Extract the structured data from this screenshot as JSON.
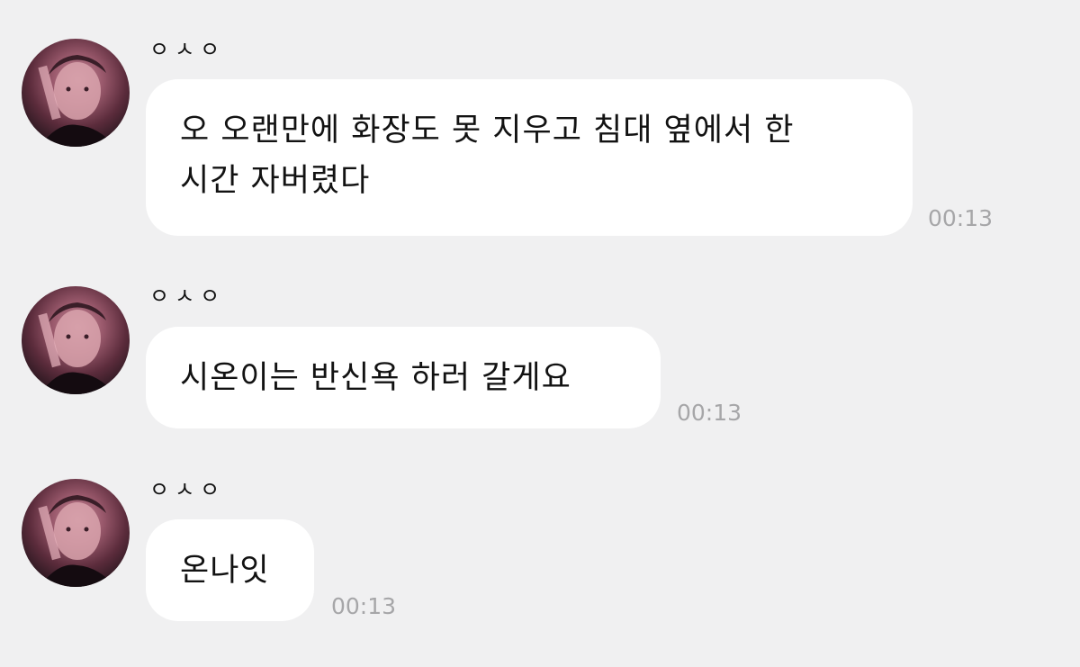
{
  "messages": [
    {
      "sender": "ㅇㅅㅇ",
      "text": "오 오랜만에 화장도 못 지우고 침대 옆에서 한\n시간 자버렸다",
      "time": "00:13"
    },
    {
      "sender": "ㅇㅅㅇ",
      "text": "시온이는 반신욕 하러 갈게요",
      "time": "00:13"
    },
    {
      "sender": "ㅇㅅㅇ",
      "text": "온나잇",
      "time": "00:13"
    }
  ],
  "colors": {
    "background": "#f0f0f1",
    "bubble": "#ffffff",
    "text": "#121212",
    "timestamp": "#a6a6a8"
  },
  "icons": {
    "avatar": "profile-photo"
  }
}
